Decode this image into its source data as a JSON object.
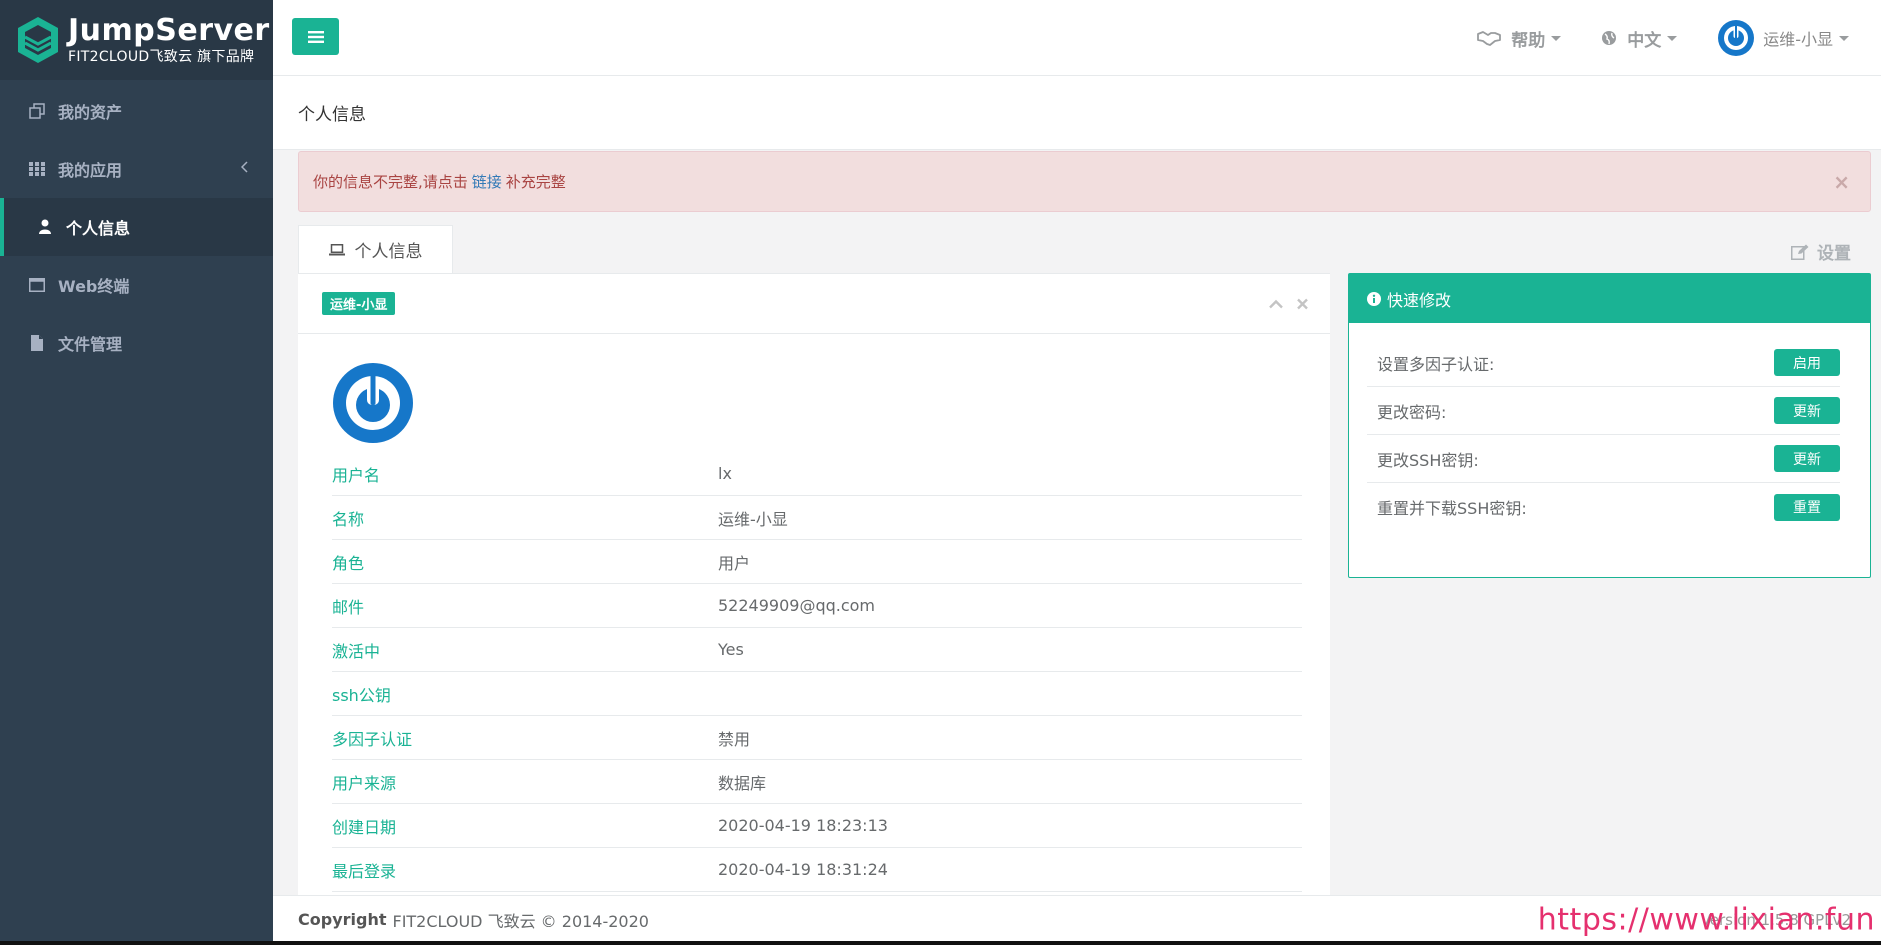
{
  "brand": {
    "title": "JumpServer",
    "subtitle": "FIT2CLOUD飞致云 旗下品牌",
    "accent": "#1ab394",
    "sidebar_bg": "#2f4050"
  },
  "sidebar": {
    "items": [
      {
        "label": "我的资产",
        "icon": "assets-icon"
      },
      {
        "label": "我的应用",
        "icon": "grid-icon"
      },
      {
        "label": "个人信息",
        "icon": "user-icon"
      },
      {
        "label": "Web终端",
        "icon": "window-icon"
      },
      {
        "label": "文件管理",
        "icon": "file-icon"
      }
    ]
  },
  "topbar": {
    "help_label": "帮助",
    "language_label": "中文",
    "user_label": "运维-小显"
  },
  "page": {
    "heading": "个人信息"
  },
  "alert": {
    "text_before": "你的信息不完整,请点击",
    "link_text": "链接",
    "text_after": "补充完整",
    "close": "×"
  },
  "tabs": {
    "profile_label": "个人信息",
    "settings_label": "设置"
  },
  "profile": {
    "badge": "运维-小显",
    "rows": [
      {
        "label": "用户名",
        "value": "lx"
      },
      {
        "label": "名称",
        "value": "运维-小显"
      },
      {
        "label": "角色",
        "value": "用户"
      },
      {
        "label": "邮件",
        "value": "52249909@qq.com"
      },
      {
        "label": "激活中",
        "value": "Yes"
      },
      {
        "label": "ssh公钥",
        "value": ""
      },
      {
        "label": "多因子认证",
        "value": "禁用"
      },
      {
        "label": "用户来源",
        "value": "数据库"
      },
      {
        "label": "创建日期",
        "value": "2020-04-19 18:23:13"
      },
      {
        "label": "最后登录",
        "value": "2020-04-19 18:31:24"
      }
    ]
  },
  "quick": {
    "title": "快速修改",
    "rows": [
      {
        "label": "设置多因子认证:",
        "button": "启用"
      },
      {
        "label": "更改密码:",
        "button": "更新"
      },
      {
        "label": "更改SSH密钥:",
        "button": "更新"
      },
      {
        "label": "重置并下载SSH密钥:",
        "button": "重置"
      }
    ]
  },
  "footer": {
    "copyright_bold": "Copyright",
    "copyright_text": "FIT2CLOUD 飞致云 © 2014-2020",
    "version": "Version 1.5.8 GPLv2",
    "watermark": "https://www.lixian.fun"
  }
}
